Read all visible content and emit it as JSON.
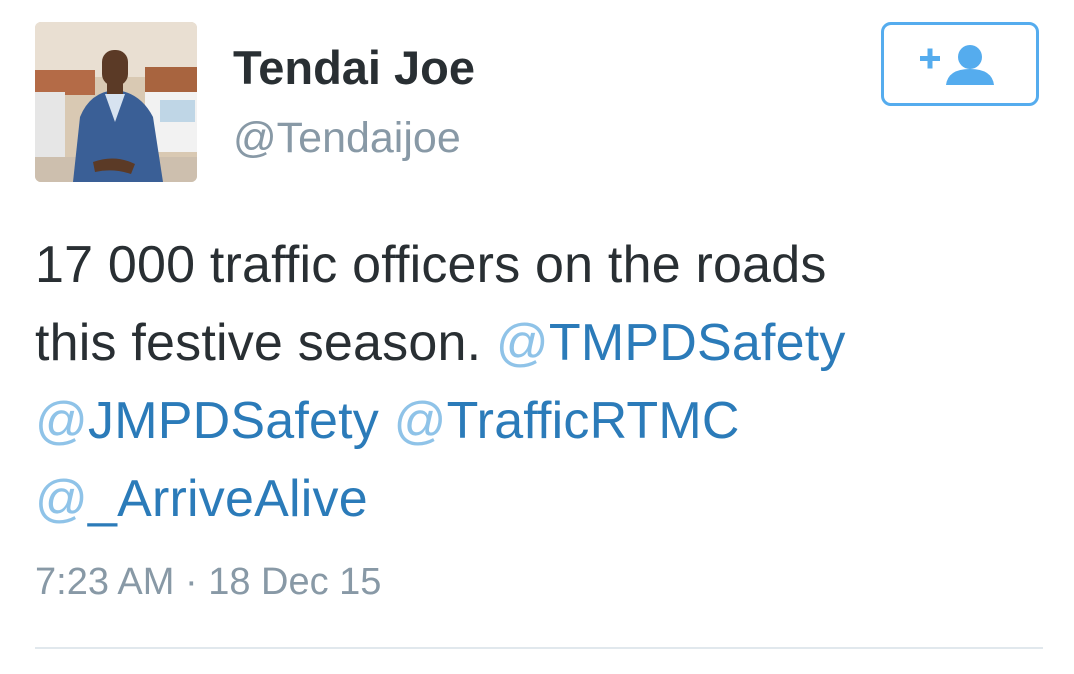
{
  "user": {
    "display_name": "Tendai Joe",
    "handle": "@Tendaijoe"
  },
  "follow_button": {
    "icon": "follow-user-icon",
    "color": "#55acee"
  },
  "tweet": {
    "text_lines": [
      "17 000 traffic officers on the roads",
      "this festive season."
    ],
    "mentions": [
      {
        "at": "@",
        "name": "TMPDSafety"
      },
      {
        "at": "@",
        "name": "JMPDSafety"
      },
      {
        "at": "@",
        "name": "TrafficRTMC"
      },
      {
        "at": "@",
        "name": "_ArriveAlive"
      }
    ],
    "timestamp": "7:23 AM · 18 Dec 15"
  },
  "colors": {
    "text": "#292f33",
    "muted": "#8899a6",
    "link": "#2b7bb9",
    "accent": "#55acee"
  }
}
